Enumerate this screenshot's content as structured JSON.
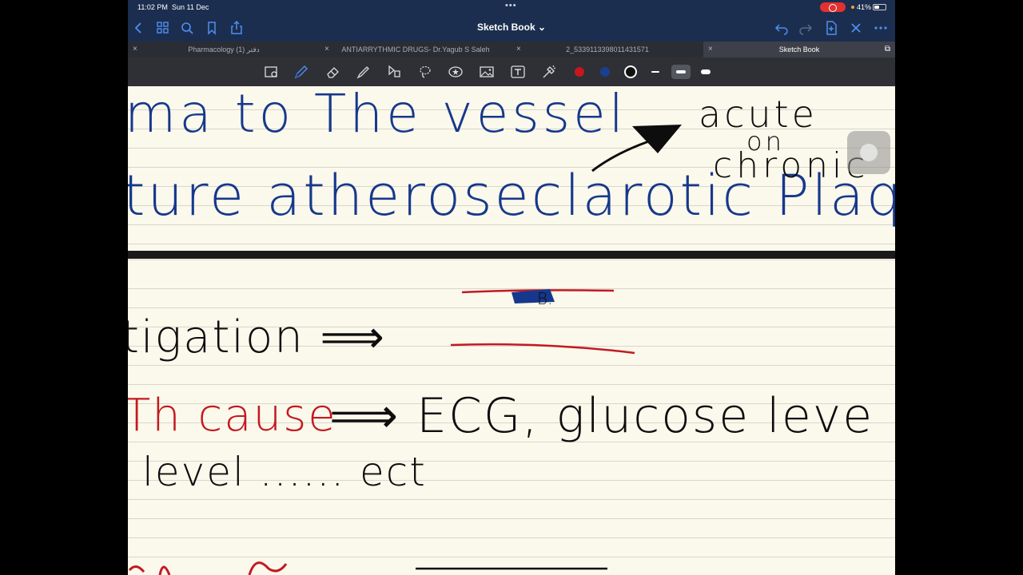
{
  "status_bar": {
    "time": "11:02 PM",
    "date": "Sun 11 Dec",
    "battery": "41%"
  },
  "nav": {
    "title": "Sketch Book ⌄"
  },
  "tabs": [
    {
      "label": "Pharmacology (1) دفتر",
      "active": false
    },
    {
      "label": "ANTIARRYTHMIC DRUGS- Dr.Yagub S Saleh",
      "active": false
    },
    {
      "label": "2_5339113398011431571",
      "active": false
    },
    {
      "label": "Sketch Book",
      "active": true
    }
  ],
  "toolbar": {
    "colors": {
      "red": "#c8161d",
      "blue": "#1b3f8f",
      "black": "#111111"
    }
  },
  "notes": {
    "page1": {
      "line1": "ma to The vessel",
      "line2": "ture atheroseclarotic Plaque",
      "side1": "acute",
      "side2": "on",
      "side3": "chronic"
    },
    "page2": {
      "line1": "tigation ⟹",
      "line2_red": "Th cause",
      "line2_black": "⟹ ECG, glucose leve",
      "line3": "level ...... ect",
      "mark": "B."
    }
  },
  "colors": {
    "ink_blue": "#16388c",
    "ink_red": "#c21a1f",
    "ink_black": "#0d0d0d",
    "paper": "#fbf8ec",
    "chrome": "#1c2e4f"
  }
}
